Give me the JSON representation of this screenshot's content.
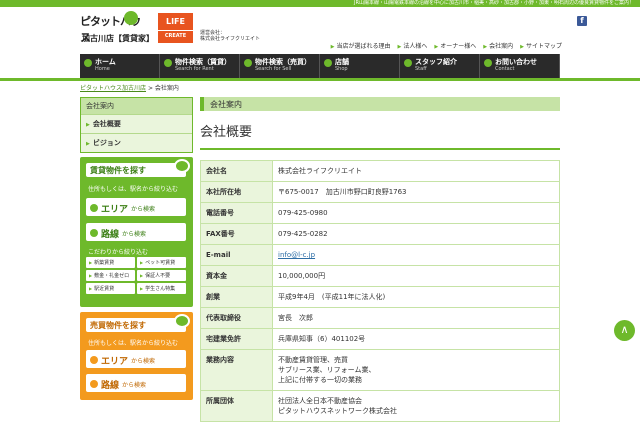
{
  "header": {
    "tagline": "JR山陽本線・山陽電鉄本線の沿線を中心に加古川市・稲美・高砂・加古郡・小野・加東・明石周辺の優良賃貸物件をご案内！",
    "logo_top": "ピタットハウス",
    "logo_bottom": "加古川店【賃貸家】",
    "brand_top": "LIFE",
    "brand_bottom": "CREATE",
    "operator_line1": "運営会社：",
    "operator_line2": "株式会社ライフクリエイト",
    "facebook": "f",
    "links": [
      "当店が選ばれる理由",
      "法人様へ",
      "オーナー様へ",
      "会社案内",
      "サイトマップ"
    ]
  },
  "nav": [
    {
      "title": "ホーム",
      "sub": "Home"
    },
    {
      "title": "物件検索（賃貸）",
      "sub": "Search for Rent"
    },
    {
      "title": "物件検索（売買）",
      "sub": "Search for Sell"
    },
    {
      "title": "店舗",
      "sub": "Shop"
    },
    {
      "title": "スタッフ紹介",
      "sub": "Staff"
    },
    {
      "title": "お問い合わせ",
      "sub": "Contact"
    }
  ],
  "breadcrumb": {
    "home": "ピタットハウス加古川店",
    "sep": ">",
    "current": "会社案内"
  },
  "sidebar": {
    "heading": "会社案内",
    "items": [
      "会社概要",
      "ビジョン"
    ],
    "rent": {
      "title": "賃貸物件を探す",
      "note": "住所もしくは、駅名から絞り込む",
      "area_main": "エリア",
      "area_sub": "から検索",
      "line_main": "路線",
      "line_sub": "から検索",
      "cond": "こだわりから絞り込む",
      "conds": [
        "新築賃貸",
        "ペット可賃貸",
        "敷金・礼金ゼロ",
        "保証人不要",
        "駅近賃貸",
        "学生さん特集"
      ]
    },
    "sale": {
      "title": "売買物件を探す",
      "note": "住所もしくは、駅名から絞り込む",
      "area_main": "エリア",
      "area_sub": "から検索",
      "line_main": "路線",
      "line_sub": "から検索"
    }
  },
  "main": {
    "section": "会社案内",
    "title": "会社概要",
    "rows": [
      {
        "k": "会社名",
        "v": "株式会社ライフクリエイト"
      },
      {
        "k": "本社所在地",
        "v": "〒675-0017　加古川市野口町良野1763"
      },
      {
        "k": "電話番号",
        "v": "079-425-0980"
      },
      {
        "k": "FAX番号",
        "v": "079-425-0282"
      },
      {
        "k": "E-mail",
        "v": "info@l-c.jp"
      },
      {
        "k": "資本金",
        "v": "10,000,000円"
      },
      {
        "k": "創業",
        "v": "平成9年4月　(平成11年に法人化)"
      },
      {
        "k": "代表取締役",
        "v": "宮長　次郎"
      },
      {
        "k": "宅建業免許",
        "v": "兵庫県知事（6）401102号"
      },
      {
        "k": "業務内容",
        "v": "不動産賃貸管理、売買\nサブリース業、リフォーム業、\n上記に付帯する一切の業務"
      },
      {
        "k": "所属団体",
        "v": "社団法人全日本不動産協会\nピタットハウスネットワーク株式会社"
      }
    ]
  },
  "totop_icon": "chevron-up-icon",
  "colors": {
    "accent": "#6eb92b",
    "orange": "#f39a1e",
    "nav": "#2a2a2a"
  }
}
